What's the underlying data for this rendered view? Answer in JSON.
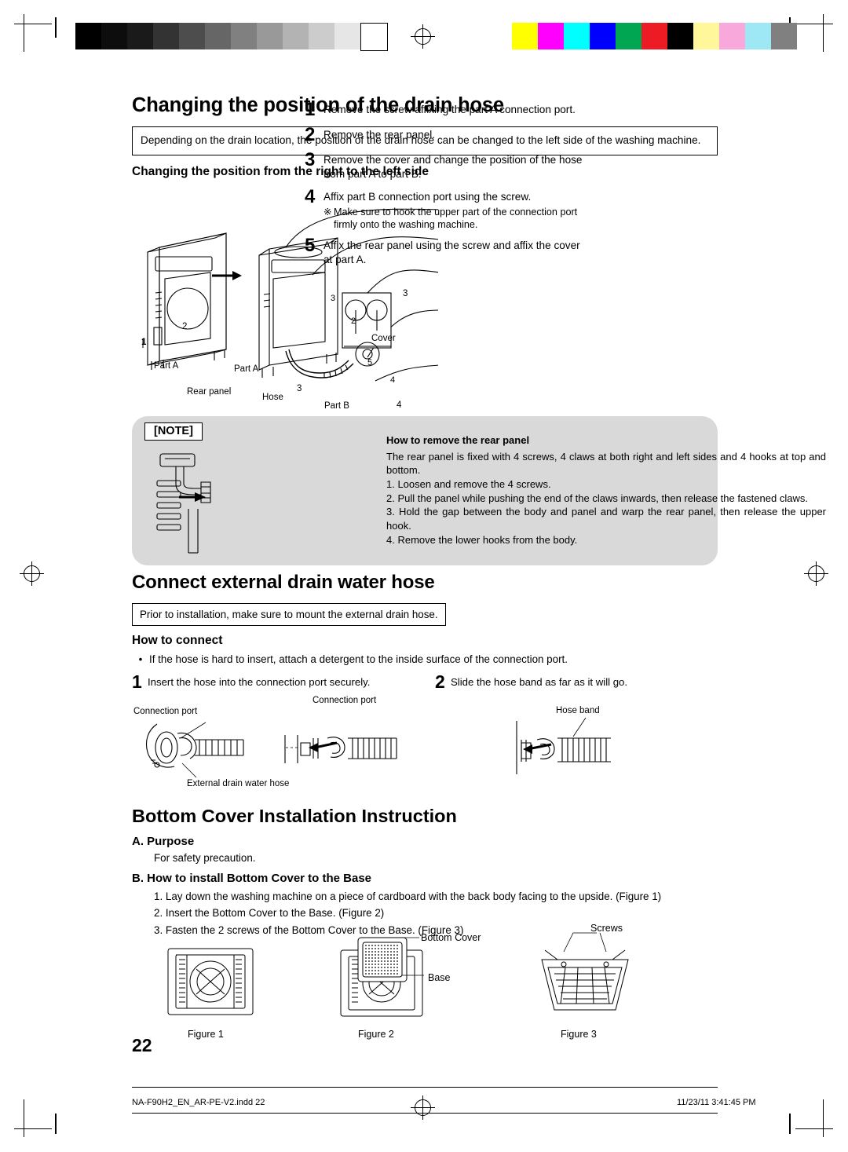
{
  "section1": {
    "title": "Changing the position of the drain hose",
    "intro": "Depending on the drain location, the position of the drain hose can be changed to the left side of the washing machine.",
    "subtitle": "Changing the position from the right to the left side",
    "steps": [
      {
        "num": "1",
        "text": "Remove the screw affixing the part A connection port."
      },
      {
        "num": "2",
        "text": "Remove the rear panel."
      },
      {
        "num": "3",
        "text": "Remove the cover and change the position of the hose from part A to part B."
      },
      {
        "num": "4",
        "text": "Affix part B connection port using the screw."
      },
      {
        "num": "5",
        "text": "Affix the rear panel using the screw and affix the cover at part A."
      }
    ],
    "substep": {
      "mark": "※",
      "text": "Make sure to hook the upper part of the connection port firmly onto the washing machine."
    },
    "figure_labels": {
      "part_a_1": "Part A",
      "part_a_2": "Part A",
      "rear_panel": "Rear panel",
      "hose": "Hose",
      "part_b": "Part B",
      "cover": "Cover",
      "callout1": "1",
      "callout2": "2",
      "callout3a": "3",
      "callout3b": "3",
      "callout4": "4",
      "callout5": "5"
    },
    "note": {
      "label": "[NOTE]",
      "heading": "How to remove the rear panel",
      "body": "The rear panel is fixed with 4 screws, 4 claws at both right and left sides and 4 hooks at top and bottom.",
      "items": [
        "1. Loosen and remove the 4 screws.",
        "2. Pull the panel while pushing the end of the claws inwards, then release the fastened claws.",
        "3. Hold the gap between the body and panel and warp the rear panel, then release the upper hook.",
        "4. Remove the lower hooks from the body."
      ]
    }
  },
  "section2": {
    "title": "Connect external drain water hose",
    "intro": "Prior to installation, make sure to mount the external drain hose.",
    "subtitle": "How to connect",
    "bullet": {
      "dot": "•",
      "text": "If the hose is hard to insert, attach a detergent to the inside surface of the connection port."
    },
    "steps": [
      {
        "num": "1",
        "text": "Insert the hose into the connection port securely."
      },
      {
        "num": "2",
        "text": "Slide the hose band as far as it will go."
      }
    ],
    "figure_labels": {
      "connection_port_left": "Connection port",
      "connection_port_mid": "Connection port",
      "external_drain_water_hose": "External drain water hose",
      "hose_band": "Hose band"
    }
  },
  "section3": {
    "title": "Bottom Cover Installation Instruction",
    "a_heading": "A. Purpose",
    "a_text": "For safety precaution.",
    "b_heading": "B. How to install Bottom Cover to the Base",
    "b_items": [
      "1. Lay down the washing machine on a piece of cardboard with the back body facing to the upside. (Figure 1)",
      "2. Insert the Bottom Cover to the Base. (Figure 2)",
      "3. Fasten the 2 screws of the Bottom Cover to the Base. (Figure 3)"
    ],
    "figure_labels": {
      "bottom_cover": "Bottom Cover",
      "base": "Base",
      "screws": "Screws",
      "figure1": "Figure 1",
      "figure2": "Figure 2",
      "figure3": "Figure 3"
    }
  },
  "page_number": "22",
  "footer": {
    "file": "NA-F90H2_EN_AR-PE-V2.indd   22",
    "timestamp": "11/23/11   3:41:45 PM"
  },
  "print_marks": {
    "grayscale": [
      "#000000",
      "#0d0d0d",
      "#1a1a1a",
      "#333333",
      "#4d4d4d",
      "#666666",
      "#808080",
      "#999999",
      "#b3b3b3",
      "#cccccc",
      "#e6e6e6",
      "#ffffff"
    ],
    "colors": [
      "#ffff00",
      "#ff00ff",
      "#00ffff",
      "#0000ff",
      "#00a651",
      "#ed1c24",
      "#000000",
      "#fff79a",
      "#f9a8dc",
      "#9ee8f5",
      "#808080"
    ]
  }
}
